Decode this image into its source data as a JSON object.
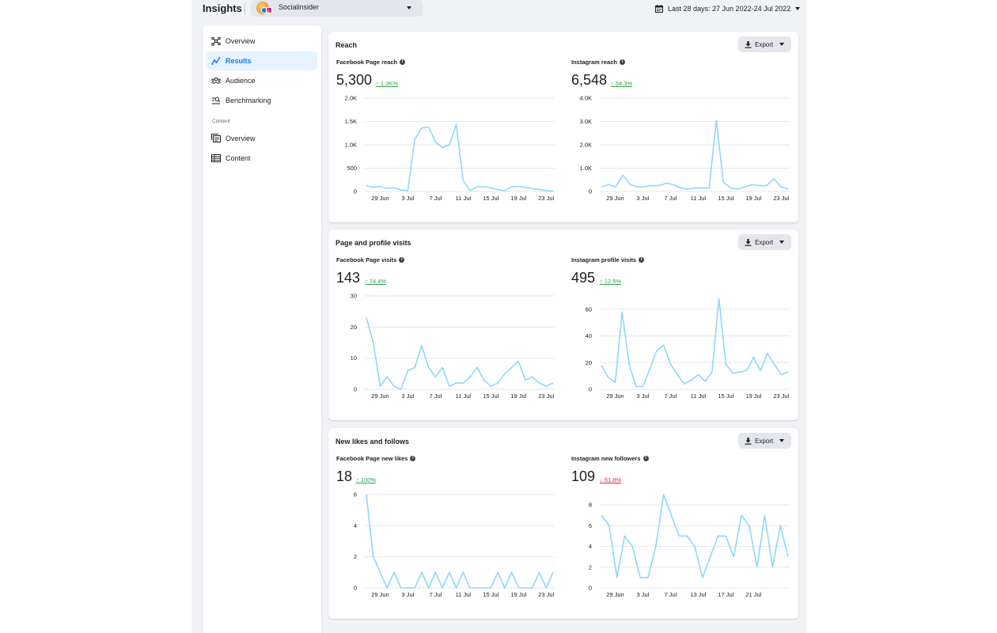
{
  "header": {
    "title": "Insights",
    "account": {
      "name": "Socialinsider"
    },
    "date_range": "Last 28 days: 27 Jun 2022-24 Jul 2022"
  },
  "sidebar": {
    "items": [
      {
        "label": "Overview",
        "icon": "overview-icon",
        "active": false
      },
      {
        "label": "Results",
        "icon": "results-icon",
        "active": true
      },
      {
        "label": "Audience",
        "icon": "audience-icon",
        "active": false
      },
      {
        "label": "Benchmarking",
        "icon": "benchmarking-icon",
        "active": false
      }
    ],
    "section_label": "Content",
    "content_items": [
      {
        "label": "Overview",
        "icon": "content-overview-icon"
      },
      {
        "label": "Content",
        "icon": "content-table-icon"
      }
    ]
  },
  "colors": {
    "line": "#8ed8f8",
    "grid": "#e4e6eb",
    "active": "#1877f2",
    "up": "#31a24c",
    "down": "#e41e3f"
  },
  "export_label": "Export",
  "cards": [
    {
      "title": "Reach",
      "metrics": [
        {
          "label": "Facebook Page reach",
          "value": "5,300",
          "change": "1.3K%",
          "direction": "up",
          "chart_data": {
            "type": "line",
            "ylim": [
              0,
              2000
            ],
            "yticks": [
              0,
              500,
              1000,
              1500,
              2000
            ],
            "ytick_labels": [
              "0",
              "500",
              "1.0K",
              "1.5K",
              "2.0K"
            ],
            "x_first": "27 Jun",
            "xticks": [
              2,
              6,
              10,
              14,
              18,
              22,
              26
            ],
            "xtick_labels": [
              "29 Jun",
              "3 Jul",
              "7 Jul",
              "11 Jul",
              "15 Jul",
              "19 Jul",
              "23 Jul"
            ],
            "values": [
              120,
              90,
              110,
              60,
              80,
              30,
              20,
              1120,
              1360,
              1380,
              1060,
              940,
              1000,
              1440,
              230,
              20,
              100,
              100,
              80,
              40,
              20,
              100,
              110,
              90,
              60,
              40,
              20,
              10
            ]
          }
        },
        {
          "label": "Instagram reach",
          "value": "6,548",
          "change": "54.3%",
          "direction": "up",
          "chart_data": {
            "type": "line",
            "ylim": [
              0,
              4000
            ],
            "yticks": [
              0,
              1000,
              2000,
              3000,
              4000
            ],
            "ytick_labels": [
              "0",
              "1.0K",
              "2.0K",
              "3.0K",
              "4.0K"
            ],
            "x_first": "27 Jun",
            "xticks": [
              2,
              6,
              10,
              14,
              18,
              22,
              26
            ],
            "xtick_labels": [
              "29 Jun",
              "3 Jul",
              "7 Jul",
              "11 Jul",
              "15 Jul",
              "19 Jul",
              "23 Jul"
            ],
            "values": [
              200,
              300,
              200,
              700,
              300,
              200,
              200,
              250,
              250,
              350,
              300,
              150,
              100,
              150,
              150,
              150,
              3050,
              400,
              150,
              100,
              200,
              300,
              250,
              250,
              550,
              200,
              100
            ]
          }
        }
      ]
    },
    {
      "title": "Page and profile visits",
      "metrics": [
        {
          "label": "Facebook Page visits",
          "value": "143",
          "change": "74.4%",
          "direction": "up",
          "chart_data": {
            "type": "line",
            "ylim": [
              0,
              30
            ],
            "yticks": [
              0,
              10,
              20,
              30
            ],
            "ytick_labels": [
              "0",
              "10",
              "20",
              "30"
            ],
            "x_first": "27 Jun",
            "xticks": [
              2,
              6,
              10,
              14,
              18,
              22,
              26
            ],
            "xtick_labels": [
              "29 Jun",
              "3 Jul",
              "7 Jul",
              "11 Jul",
              "15 Jul",
              "19 Jul",
              "23 Jul"
            ],
            "values": [
              23,
              15,
              1,
              4,
              1,
              0,
              6,
              7,
              14,
              7,
              4,
              7,
              1,
              2,
              2,
              4,
              7,
              3,
              1,
              2,
              5,
              7,
              9,
              3,
              4,
              2,
              1,
              2
            ]
          }
        },
        {
          "label": "Instagram profile visits",
          "value": "495",
          "change": "12.5%",
          "direction": "up",
          "chart_data": {
            "type": "line",
            "ylim": [
              0,
              70
            ],
            "yticks": [
              0,
              20,
              40,
              60
            ],
            "ytick_labels": [
              "0",
              "20",
              "40",
              "60"
            ],
            "x_first": "27 Jun",
            "xticks": [
              2,
              6,
              10,
              14,
              18,
              22,
              26
            ],
            "xtick_labels": [
              "29 Jun",
              "3 Jul",
              "7 Jul",
              "11 Jul",
              "15 Jul",
              "19 Jul",
              "23 Jul"
            ],
            "values": [
              18,
              9,
              5,
              58,
              19,
              2,
              2,
              15,
              29,
              33,
              19,
              11,
              4,
              7,
              11,
              6,
              13,
              68,
              19,
              12,
              13,
              14,
              24,
              14,
              27,
              19,
              11,
              13
            ]
          }
        }
      ]
    },
    {
      "title": "New likes and follows",
      "metrics": [
        {
          "label": "Facebook Page new likes",
          "value": "18",
          "change": "100%",
          "direction": "up",
          "chart_data": {
            "type": "line",
            "ylim": [
              0,
              6
            ],
            "yticks": [
              0,
              2,
              4,
              6
            ],
            "ytick_labels": [
              "0",
              "2",
              "4",
              "6"
            ],
            "x_first": "27 Jun",
            "xticks": [
              2,
              6,
              10,
              14,
              18,
              22,
              26
            ],
            "xtick_labels": [
              "29 Jun",
              "3 Jul",
              "7 Jul",
              "11 Jul",
              "15 Jul",
              "19 Jul",
              "23 Jul"
            ],
            "values": [
              6,
              2,
              1,
              0,
              1,
              0,
              0,
              0,
              1,
              0,
              1,
              0,
              1,
              0,
              1,
              0,
              0,
              0,
              0,
              1,
              0,
              1,
              0,
              0,
              0,
              1,
              0,
              1
            ]
          }
        },
        {
          "label": "Instagram new followers",
          "value": "109",
          "change": "51.8%",
          "direction": "down",
          "chart_data": {
            "type": "line",
            "ylim": [
              0,
              9
            ],
            "yticks": [
              0,
              2,
              4,
              6,
              8
            ],
            "ytick_labels": [
              "0",
              "2",
              "4",
              "6",
              "8"
            ],
            "x_first": "27 Jun",
            "xticks": [
              2,
              6,
              10,
              14,
              18,
              22,
              26
            ],
            "xtick_labels": [
              "29 Jun",
              "3 Jul",
              "7 Jul",
              "13 Jul",
              "17 Jul",
              "21 Jul"
            ],
            "values": [
              7,
              6,
              1,
              5,
              4,
              1,
              1,
              4,
              9,
              7,
              5,
              5,
              4,
              1,
              3,
              5,
              5,
              3,
              7,
              6,
              2,
              7,
              2,
              6,
              3
            ]
          }
        }
      ]
    }
  ]
}
